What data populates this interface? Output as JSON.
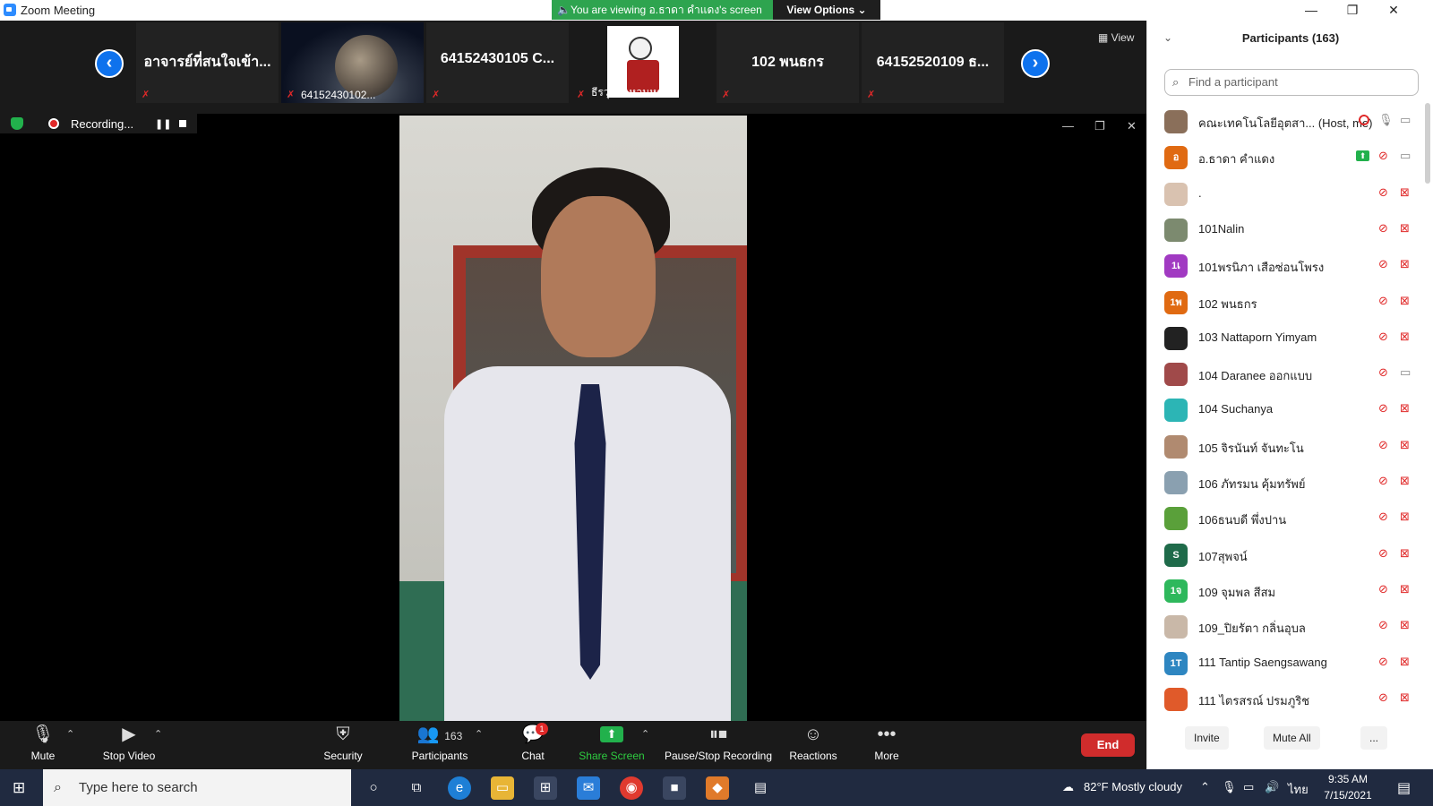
{
  "window": {
    "title": "Zoom Meeting",
    "viewing_banner": "🔈You are viewing อ.ธาดา คำแดง's screen",
    "view_options": "View Options ⌄"
  },
  "gallery": {
    "view_label": "View",
    "thumbnails": [
      {
        "name": "อาจารย์ที่สนใจเข้า...",
        "sublabel": ""
      },
      {
        "name": "",
        "sublabel": "64152430102..."
      },
      {
        "name": "64152430105 C...",
        "sublabel": ""
      },
      {
        "name": "",
        "sublabel": "ธีรวุฒิ แหวนหล่อ"
      },
      {
        "name": "102 พนธกร",
        "sublabel": ""
      },
      {
        "name": "64152520109 ธ...",
        "sublabel": ""
      }
    ]
  },
  "recording": {
    "label": "Recording..."
  },
  "toolbar": {
    "mute": "Mute",
    "stop_video": "Stop Video",
    "security": "Security",
    "participants": "Participants",
    "participants_count": "163",
    "chat": "Chat",
    "chat_badge": "1",
    "share_screen": "Share Screen",
    "pause_stop_recording": "Pause/Stop Recording",
    "reactions": "Reactions",
    "more": "More",
    "end": "End"
  },
  "panel": {
    "title": "Participants (163)",
    "search_placeholder": "Find a participant",
    "participants": [
      {
        "name": "คณะเทคโนโลยีอุตสา... (Host, me)",
        "avatar": "",
        "color": "#8a6f5a",
        "mic": "on",
        "cam": "on",
        "status": "recording"
      },
      {
        "name": "อ.ธาดา คำแดง",
        "avatar": "อ",
        "color": "#e06a12",
        "mic": "muted",
        "cam": "on",
        "status": "sharing"
      },
      {
        "name": ".",
        "avatar": "",
        "color": "#d9c2b0",
        "mic": "muted",
        "cam": "off",
        "status": ""
      },
      {
        "name": "101Nalin",
        "avatar": "",
        "color": "#7c8a6f",
        "mic": "muted",
        "cam": "off",
        "status": ""
      },
      {
        "name": "101พรนิภา เสือซ่อนโพรง",
        "avatar": "1เ",
        "color": "#a13ac2",
        "mic": "muted",
        "cam": "off",
        "status": ""
      },
      {
        "name": "102 พนธกร",
        "avatar": "1พ",
        "color": "#e06a12",
        "mic": "muted",
        "cam": "off",
        "status": ""
      },
      {
        "name": "103 Nattaporn Yimyam",
        "avatar": "",
        "color": "#222222",
        "mic": "muted",
        "cam": "off",
        "status": ""
      },
      {
        "name": "104 Daranee ออกแบบ",
        "avatar": "",
        "color": "#a04a4a",
        "mic": "muted",
        "cam": "on",
        "status": ""
      },
      {
        "name": "104 Suchanya",
        "avatar": "",
        "color": "#2cb5b5",
        "mic": "muted",
        "cam": "off",
        "status": ""
      },
      {
        "name": "105 จิรนันท์ จันทะโน",
        "avatar": "",
        "color": "#b08a70",
        "mic": "muted",
        "cam": "off",
        "status": ""
      },
      {
        "name": "106 ภัทรมน คุ้มทรัพย์",
        "avatar": "",
        "color": "#8aa0b0",
        "mic": "muted",
        "cam": "off",
        "status": ""
      },
      {
        "name": "106ธนบดี พึ่งปาน",
        "avatar": "",
        "color": "#5aa03a",
        "mic": "muted",
        "cam": "off",
        "status": ""
      },
      {
        "name": "107สุพจน์",
        "avatar": "S",
        "color": "#1f6b4a",
        "mic": "muted",
        "cam": "off",
        "status": ""
      },
      {
        "name": "109 จุมพล สีสม",
        "avatar": "1จ",
        "color": "#2eb85c",
        "mic": "muted",
        "cam": "off",
        "status": ""
      },
      {
        "name": "109_ปิยรัตา กลิ่นอุบล",
        "avatar": "",
        "color": "#c9b8a8",
        "mic": "muted",
        "cam": "off",
        "status": ""
      },
      {
        "name": "111 Tantip Saengsawang",
        "avatar": "1T",
        "color": "#2e86c1",
        "mic": "muted",
        "cam": "off",
        "status": ""
      },
      {
        "name": "111 ไตรสรณ์ ปรมภูริช",
        "avatar": "",
        "color": "#e05a2a",
        "mic": "muted",
        "cam": "off",
        "status": ""
      }
    ],
    "invite": "Invite",
    "mute_all": "Mute All",
    "more": "..."
  },
  "taskbar": {
    "search_placeholder": "Type here to search",
    "weather": "82°F  Mostly cloudy",
    "language": "ไทย",
    "time": "9:35 AM",
    "date": "7/15/2021"
  },
  "colors": {
    "accent_blue": "#0e72ed",
    "share_green": "#22b14c",
    "end_red": "#d02c2c",
    "muted_red": "#e02828"
  }
}
